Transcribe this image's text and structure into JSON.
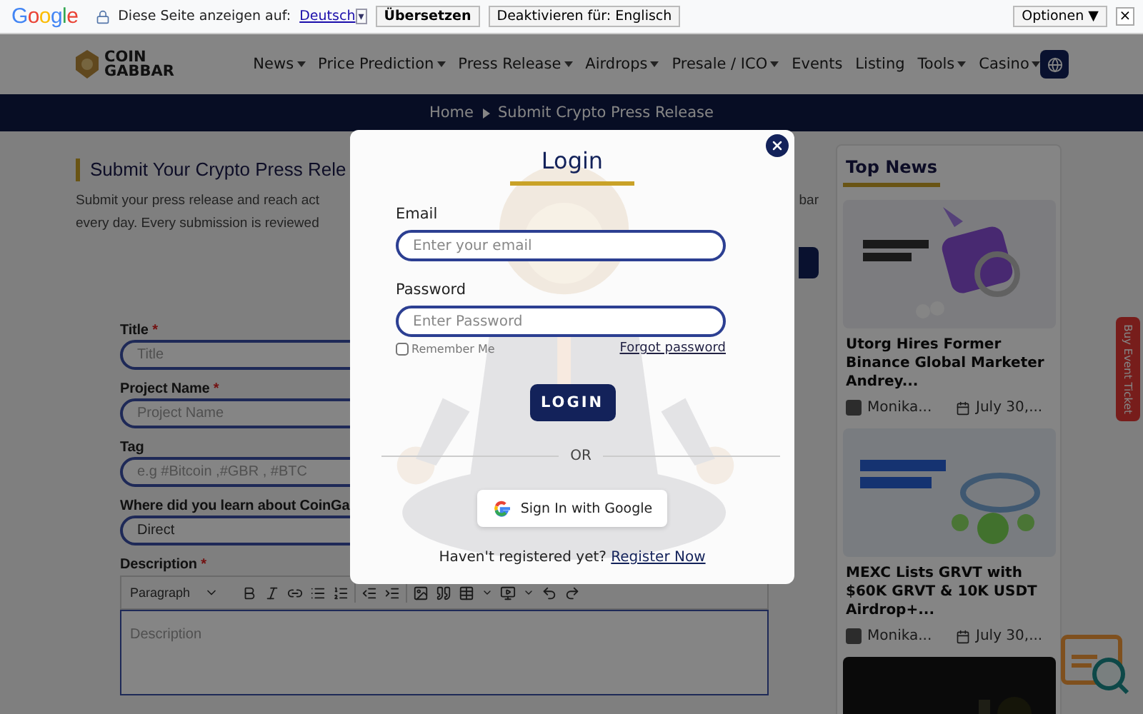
{
  "translate_bar": {
    "logo": "Google",
    "prompt": "Diese Seite anzeigen auf:",
    "language": "Deutsch",
    "language_caret": "▾",
    "buttons": [
      "Übersetzen",
      "Deaktivieren für: Englisch"
    ],
    "options": "Optionen ▼",
    "close": "×"
  },
  "header": {
    "logo_lines": [
      "COIN",
      "GABBAR"
    ],
    "nav": [
      {
        "label": "News",
        "dropdown": true
      },
      {
        "label": "Price Prediction",
        "dropdown": true
      },
      {
        "label": "Press Release",
        "dropdown": true
      },
      {
        "label": "Airdrops",
        "dropdown": true
      },
      {
        "label": "Presale / ICO",
        "dropdown": true
      },
      {
        "label": "Events",
        "dropdown": false
      },
      {
        "label": "Listing",
        "dropdown": false
      },
      {
        "label": "Tools",
        "dropdown": true
      },
      {
        "label": "Casino",
        "dropdown": true
      }
    ]
  },
  "breadcrumb": [
    "Home",
    "Submit Crypto Press Release"
  ],
  "page": {
    "heading": "Submit Your Crypto Press Rele",
    "intro_lines": [
      "Submit your press release and reach act",
      "every day. Every submission is reviewed"
    ],
    "intro_tail": "bar"
  },
  "form": {
    "fields": [
      {
        "kind": "input",
        "label": "Title",
        "required_mark": "*",
        "placeholder": "Title"
      },
      {
        "kind": "input",
        "label": "Project Name",
        "required_mark": "*",
        "placeholder": "Project Name"
      },
      {
        "kind": "input",
        "label": "Tag",
        "placeholder": "e.g #Bitcoin ,#GBR , #BTC"
      },
      {
        "kind": "select",
        "label": "Where did you learn about CoinGa",
        "value": "Direct"
      }
    ],
    "description": {
      "label": "Description",
      "required_mark": "*",
      "format": "Paragraph",
      "placeholder": "Description"
    }
  },
  "sidebar": {
    "title": "Top News",
    "items": [
      {
        "kind": "news",
        "title": "Utorg Hires Former Binance Global Marketer Andrey...",
        "author": "Monika...",
        "date": "July 30,..."
      },
      {
        "kind": "news",
        "title": "MEXC Lists GRVT with $60K GRVT & 10K USDT Airdrop+...",
        "author": "Monika...",
        "date": "July 30,..."
      },
      {
        "kind": "picture"
      }
    ]
  },
  "side_tab": "Buy Event Ticket",
  "modal": {
    "title": "Login",
    "email_label": "Email",
    "email_placeholder": "Enter your email",
    "password_label": "Password",
    "password_placeholder": "Enter Password",
    "remember": {
      "label": "Remember Me",
      "checked": false
    },
    "forgot": "Forgot password",
    "login": "LOGIN",
    "divider": "OR",
    "google": "Sign In with Google",
    "register_prompt": "Haven't registered yet?",
    "register_link": "Register Now"
  }
}
